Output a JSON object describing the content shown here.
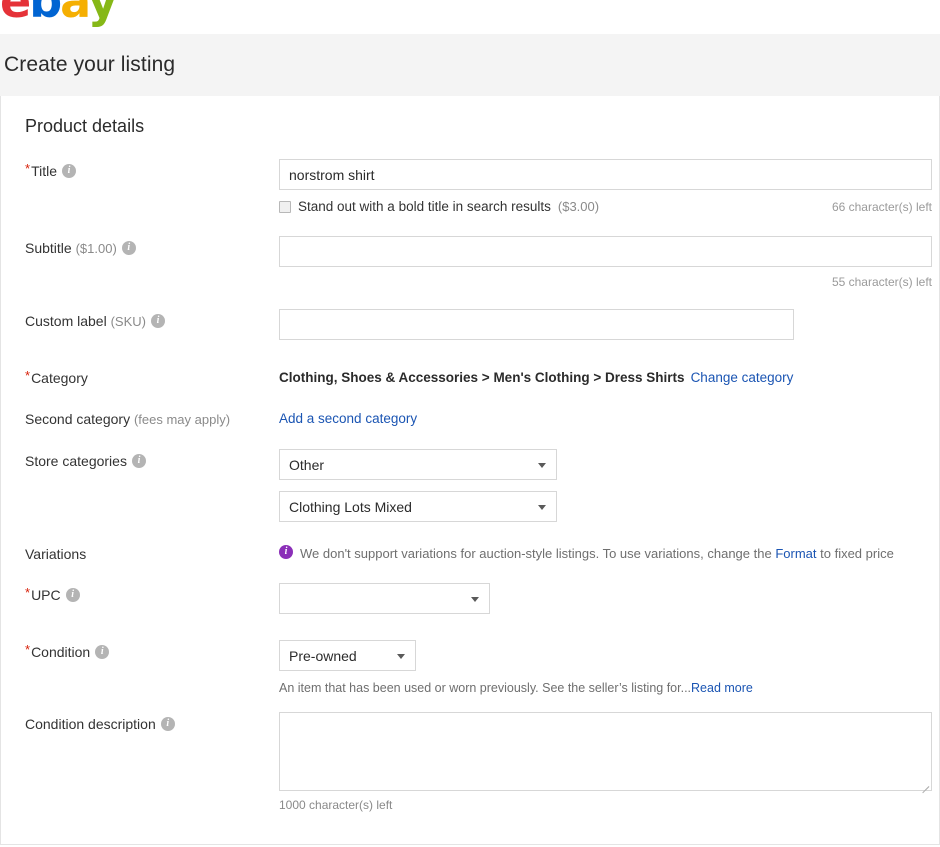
{
  "brand": {
    "logo_letters": [
      "e",
      "b",
      "a",
      "y"
    ],
    "colors": {
      "e": "#e53238",
      "b": "#0064d2",
      "a": "#f5af02",
      "y": "#86b817",
      "link": "#1b55b3",
      "required": "#d8210a",
      "info_purple": "#8b2fb8"
    }
  },
  "header": {
    "page_title": "Create your listing"
  },
  "section": {
    "heading": "Product details"
  },
  "title_row": {
    "label": "Title",
    "required_mark": "*",
    "info_icon": "info-icon",
    "value": "norstrom shirt",
    "placeholder": "",
    "bold_checkbox_label": "Stand out with a bold title in search results",
    "bold_checkbox_price": "($3.00)",
    "bold_checkbox_checked": false,
    "counter": "66 character(s) left"
  },
  "subtitle_row": {
    "label": "Subtitle",
    "price_note": "($1.00)",
    "info_icon": "info-icon",
    "value": "",
    "placeholder": "",
    "counter": "55 character(s) left"
  },
  "sku_row": {
    "label": "Custom label",
    "sub_note": "(SKU)",
    "info_icon": "info-icon",
    "value": "",
    "placeholder": ""
  },
  "category_row": {
    "label": "Category",
    "required_mark": "*",
    "breadcrumb": "Clothing, Shoes & Accessories > Men's Clothing > Dress Shirts",
    "change_link": "Change category"
  },
  "second_category_row": {
    "label": "Second category",
    "sub_note": "(fees may apply)",
    "add_link": "Add a second category"
  },
  "store_categories_row": {
    "label": "Store categories",
    "info_icon": "info-icon",
    "select_1_value": "Other",
    "select_2_value": "Clothing Lots Mixed",
    "caret_icon": "chevron-down-icon"
  },
  "variations_row": {
    "label": "Variations",
    "info_icon": "info-icon-purple",
    "message_before": "We don't support variations for auction-style listings. To use variations, change the",
    "format_link": "Format",
    "message_after": "to fixed price"
  },
  "upc_row": {
    "label": "UPC",
    "required_mark": "*",
    "info_icon": "info-icon",
    "value": "",
    "caret_icon": "chevron-down-icon"
  },
  "condition_row": {
    "label": "Condition",
    "required_mark": "*",
    "info_icon": "info-icon",
    "value": "Pre-owned",
    "caret_icon": "chevron-down-icon",
    "help_text": "An item that has been used or worn previously. See the seller’s listing for...",
    "help_link": "Read more"
  },
  "condition_description_row": {
    "label": "Condition description",
    "info_icon": "info-icon",
    "value": "",
    "placeholder": "",
    "counter": "1000 character(s) left",
    "resize_grip": "resize-grip-icon"
  }
}
